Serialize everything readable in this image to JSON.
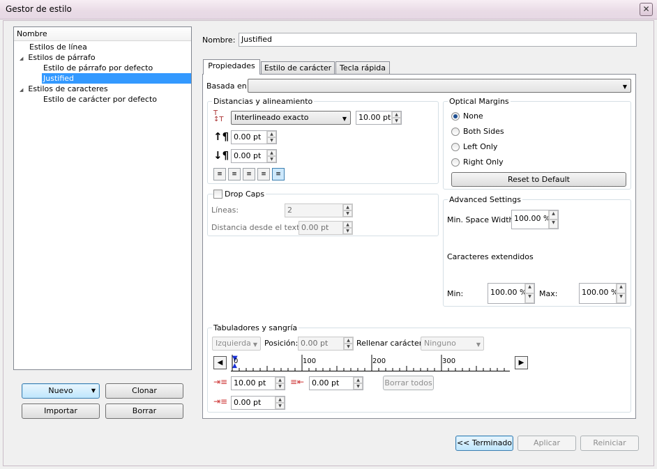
{
  "window": {
    "title": "Gestor de estilo",
    "close_glyph": "✕"
  },
  "tree": {
    "header": "Nombre",
    "items": [
      {
        "label": "Estilos de línea"
      },
      {
        "label": "Estilos de párrafo"
      },
      {
        "label": "Estilo de párrafo por defecto"
      },
      {
        "label": "Justified"
      },
      {
        "label": "Estilos de caracteres"
      },
      {
        "label": "Estilo de carácter por defecto"
      }
    ]
  },
  "left_buttons": {
    "new": "Nuevo",
    "clone": "Clonar",
    "import": "Importar",
    "delete": "Borrar"
  },
  "name_field": {
    "label": "Nombre:",
    "value": "Justified"
  },
  "tabs": [
    "Propiedades",
    "Estilo de carácter",
    "Tecla rápida"
  ],
  "based_on": {
    "label": "Basada en:",
    "value": ""
  },
  "spacing": {
    "title": "Distancias y alineamiento",
    "line_mode": "Interlineado exacto",
    "line_value": "10.00 pt",
    "above": "0.00 pt",
    "below": "0.00 pt"
  },
  "dropcaps": {
    "label": "Drop Caps",
    "lines_label": "Líneas:",
    "lines_value": "2",
    "dist_label": "Distancia desde el texto:",
    "dist_value": "0.00 pt"
  },
  "optical": {
    "title": "Optical Margins",
    "options": [
      "None",
      "Both Sides",
      "Left Only",
      "Right Only"
    ],
    "reset": "Reset to Default"
  },
  "advanced": {
    "title": "Advanced Settings",
    "min_space_label": "Min. Space Width:",
    "min_space_value": "100.00 %",
    "extended_label": "Caracteres extendidos",
    "min_label": "Min:",
    "min_value": "100.00 %",
    "max_label": "Max:",
    "max_value": "100.00 %"
  },
  "tabs_indent": {
    "title": "Tabuladores y sangría",
    "align_value": "Izquierda",
    "position_label": "Posición:",
    "position_value": "0.00 pt",
    "fill_label": "Rellenar carácter:",
    "fill_value": "Ninguno",
    "ruler_labels": [
      "0",
      "100",
      "200",
      "300"
    ],
    "first_indent": "10.00 pt",
    "right_indent": "0.00 pt",
    "left_indent": "0.00 pt",
    "clear_all": "Borrar todos"
  },
  "bottom": {
    "done": "<< Terminado",
    "apply": "Aplicar",
    "reset": "Reiniciar"
  }
}
